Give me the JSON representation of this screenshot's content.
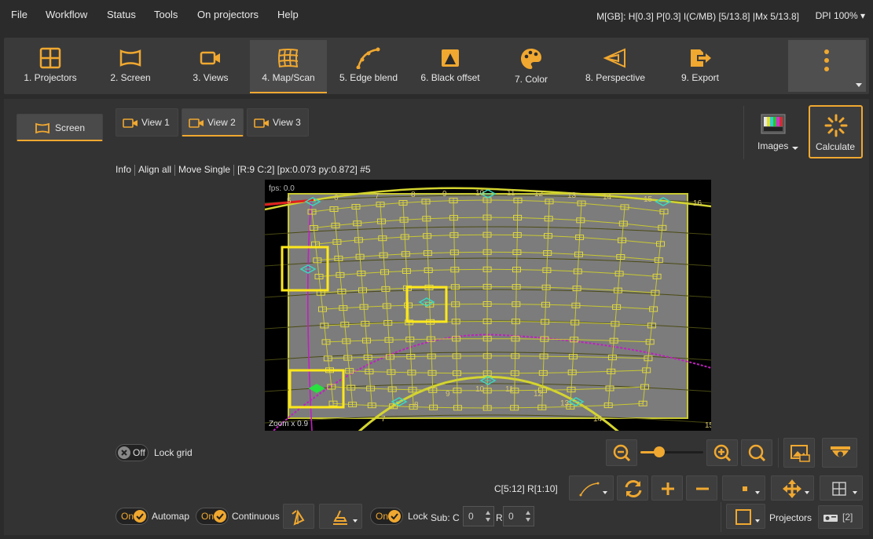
{
  "menu": [
    "File",
    "Workflow",
    "Status",
    "Tools",
    "On projectors",
    "Help"
  ],
  "status": {
    "memory": "M[GB]: H[0.3] P[0.3] I(C/MB) [5/13.8] |Mx 5/13.8]",
    "dpi": "DPI 100%"
  },
  "toolbar": {
    "tools": [
      {
        "label": "1. Projectors",
        "icon": "grid-icon"
      },
      {
        "label": "2. Screen",
        "icon": "screen-icon"
      },
      {
        "label": "3. Views",
        "icon": "camera-icon"
      },
      {
        "label": "4. Map/Scan",
        "icon": "warp-grid-icon"
      },
      {
        "label": "5. Edge blend",
        "icon": "curve-icon"
      },
      {
        "label": "6. Black offset",
        "icon": "black-offset-icon"
      },
      {
        "label": "7. Color",
        "icon": "palette-icon"
      },
      {
        "label": "8. Perspective",
        "icon": "perspective-icon"
      },
      {
        "label": "9. Export",
        "icon": "export-icon"
      }
    ],
    "active": "4. Map/Scan"
  },
  "left": {
    "screen_button": "Screen"
  },
  "views": [
    "View 1",
    "View 2",
    "View 3"
  ],
  "selected_view": "View 2",
  "right_panel": {
    "images_label": "Images",
    "calculate_label": "Calculate"
  },
  "infobar": {
    "info": "Info",
    "align_all": "Align all",
    "move_single": "Move Single",
    "readout": "[R:9 C:2] [px:0.073 py:0.872] #5"
  },
  "viewport": {
    "fps": "fps: 0.0",
    "zoom": "Zoom x 0.9",
    "top_labels": [
      "5",
      "6",
      "7",
      "8",
      "9",
      "10",
      "11",
      "12",
      "13",
      "14",
      "15",
      "16"
    ],
    "bottom_labels": [
      "7",
      "8",
      "9",
      "10",
      "11",
      "12",
      "13",
      "14",
      "15"
    ]
  },
  "lock_grid": {
    "state": "Off",
    "label": "Lock grid"
  },
  "zoom_slider": {
    "level": 0.3
  },
  "grid_info": "C[5:12] R[1:10]",
  "bottom": {
    "automap": {
      "state": "On",
      "label": "Automap"
    },
    "continuous": {
      "state": "On",
      "label": "Continuous"
    },
    "lock": {
      "state": "On",
      "label": "Lock"
    },
    "sub_label": "Sub: C",
    "sub_c": "0",
    "r_label": "R",
    "sub_r": "0",
    "projectors_label": "Projectors",
    "projectors_count": "[2]"
  },
  "colors": {
    "accent": "#f0a830",
    "grid": "#c8c832",
    "marker": "#3ad8c0",
    "highlight": "#ffe81a",
    "arc": "#c020c0"
  }
}
